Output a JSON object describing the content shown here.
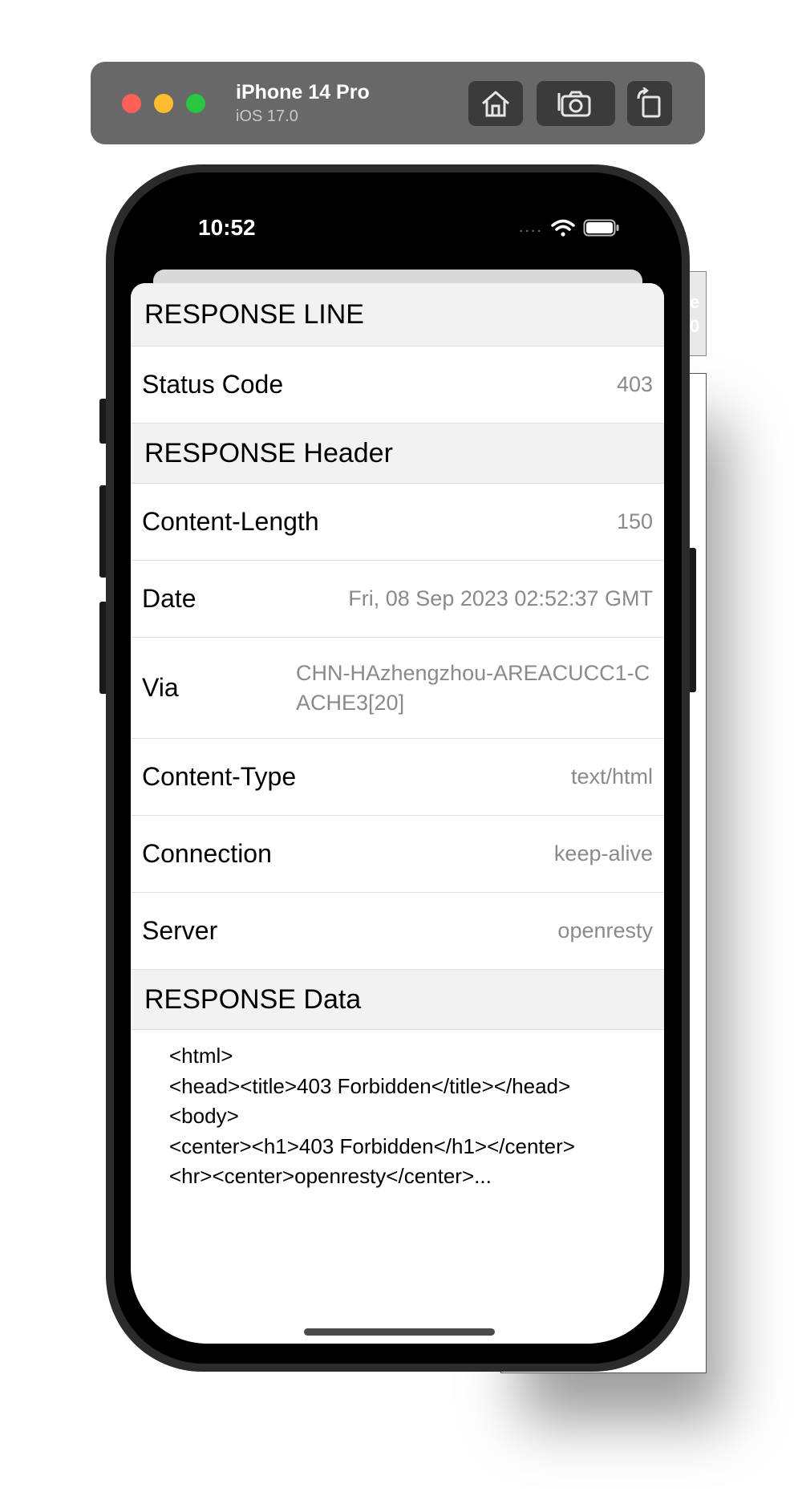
{
  "simulator": {
    "device_name": "iPhone 14 Pro",
    "os_version": "iOS 17.0",
    "icons": [
      "home-icon",
      "camera-icon",
      "rotate-icon"
    ]
  },
  "status_bar": {
    "time": "10:52",
    "signal": "....",
    "icons": [
      "wifi-icon",
      "battery-icon"
    ]
  },
  "sections": {
    "line": {
      "title": "RESPONSE LINE",
      "rows": [
        {
          "key": "Status Code",
          "value": "403"
        }
      ]
    },
    "header": {
      "title": "RESPONSE Header",
      "rows": [
        {
          "key": "Content-Length",
          "value": "150"
        },
        {
          "key": "Date",
          "value": "Fri, 08 Sep 2023 02:52:37 GMT"
        },
        {
          "key": "Via",
          "value": "CHN-HAzhengzhou-AREACUCC1-CACHE3[20]"
        },
        {
          "key": "Content-Type",
          "value": "text/html"
        },
        {
          "key": "Connection",
          "value": "keep-alive"
        },
        {
          "key": "Server",
          "value": "openresty"
        }
      ]
    },
    "data": {
      "title": "RESPONSE Data",
      "body": "<html>\n<head><title>403 Forbidden</title></head>\n<body>\n<center><h1>403 Forbidden</h1></center>\n<hr><center>openresty</center>..."
    }
  },
  "background_window": {
    "partial_glyphs": [
      "e",
      "0"
    ]
  }
}
